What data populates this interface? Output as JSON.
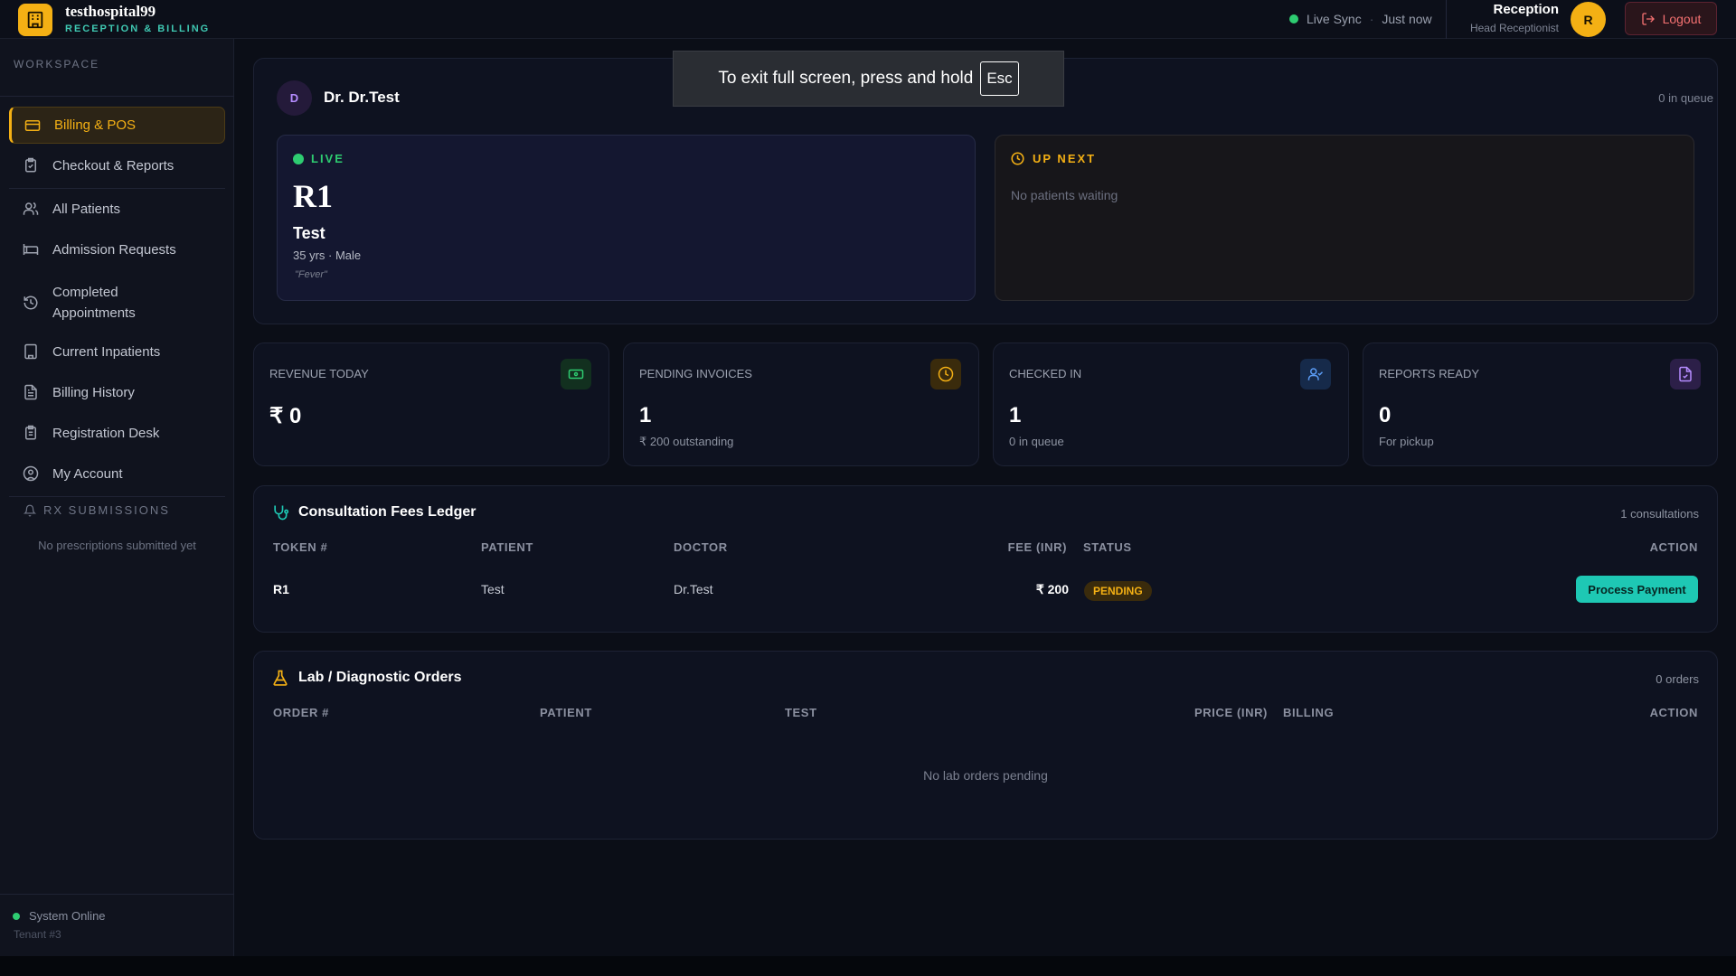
{
  "header": {
    "hospital_name": "testhospital99",
    "hospital_subtitle": "RECEPTION & BILLING",
    "live_sync": "Live Sync",
    "sync_time": "Just now",
    "user_name": "Reception",
    "user_role": "Head Receptionist",
    "avatar_initial": "R",
    "logout_label": "Logout"
  },
  "sidebar": {
    "section_label": "WORKSPACE",
    "items": [
      {
        "label": "Billing & POS",
        "icon": "credit-card-icon",
        "active": true
      },
      {
        "label": "Checkout & Reports",
        "icon": "clipboard-check-icon"
      },
      {
        "label": "All Patients",
        "icon": "users-icon"
      },
      {
        "label": "Admission Requests",
        "icon": "bed-icon"
      },
      {
        "label": "Completed Appointments",
        "icon": "history-icon"
      },
      {
        "label": "Current Inpatients",
        "icon": "building-icon"
      },
      {
        "label": "Billing History",
        "icon": "file-text-icon"
      },
      {
        "label": "Registration Desk",
        "icon": "clipboard-list-icon"
      },
      {
        "label": "My Account",
        "icon": "user-circle-icon"
      }
    ],
    "rx_label": "RX SUBMISSIONS",
    "rx_empty": "No prescriptions submitted yet",
    "system_status": "System Online",
    "tenant": "Tenant #3"
  },
  "doctor_panel": {
    "avatar_initial": "D",
    "doctor_name": "Dr. Dr.Test",
    "queue_count": "0 in queue",
    "live": {
      "label": "LIVE",
      "token": "R1",
      "patient": "Test",
      "meta": "35 yrs · Male",
      "note": "\"Fever\""
    },
    "up_next": {
      "label": "UP NEXT",
      "empty": "No patients waiting"
    }
  },
  "stats": [
    {
      "label": "REVENUE TODAY",
      "value": "₹ 0",
      "sub": "",
      "icon": "banknote-icon",
      "color": "#2ecc71"
    },
    {
      "label": "PENDING INVOICES",
      "value": "1",
      "sub": "₹ 200 outstanding",
      "icon": "clock-icon",
      "color": "#f4b014"
    },
    {
      "label": "CHECKED IN",
      "value": "1",
      "sub": "0 in queue",
      "icon": "user-check-icon",
      "color": "#5b9cf5"
    },
    {
      "label": "REPORTS READY",
      "value": "0",
      "sub": "For pickup",
      "icon": "file-report-icon",
      "color": "#b58cff"
    }
  ],
  "consultation": {
    "title": "Consultation Fees Ledger",
    "count": "1 consultations",
    "columns": [
      "TOKEN #",
      "PATIENT",
      "DOCTOR",
      "FEE (INR)",
      "STATUS",
      "ACTION"
    ],
    "rows": [
      {
        "token": "R1",
        "patient": "Test",
        "doctor": "Dr.Test",
        "fee": "₹ 200",
        "status": "PENDING",
        "action": "Process Payment"
      }
    ]
  },
  "lab": {
    "title": "Lab / Diagnostic Orders",
    "count": "0 orders",
    "columns": [
      "ORDER #",
      "PATIENT",
      "TEST",
      "PRICE (INR)",
      "BILLING",
      "ACTION"
    ],
    "empty": "No lab orders pending"
  },
  "fullscreen_toast": {
    "text": "To exit full screen, press and hold",
    "key": "Esc"
  }
}
